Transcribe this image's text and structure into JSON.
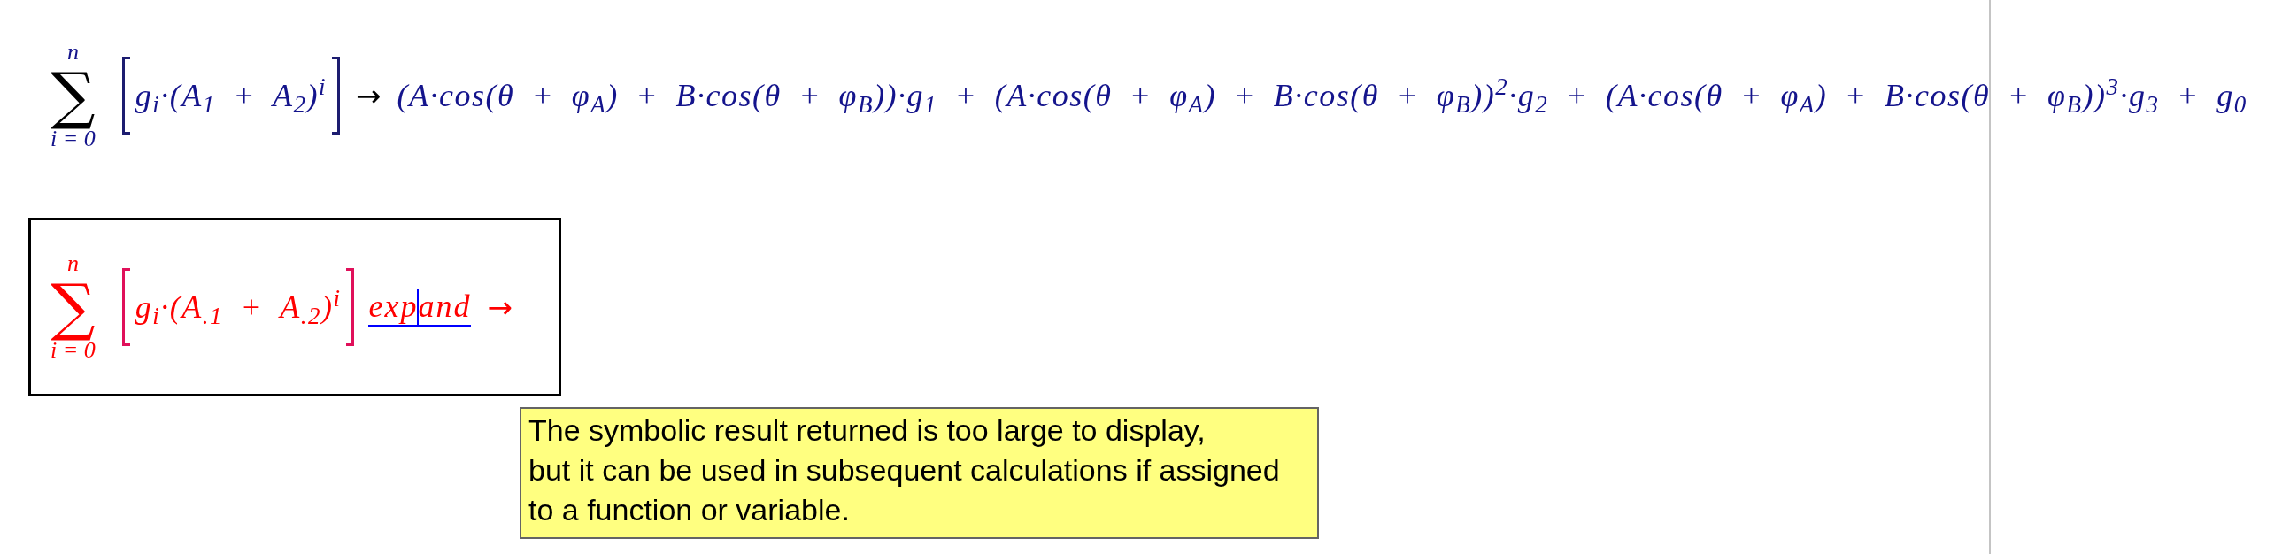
{
  "worksheet": {
    "regions": [
      {
        "selected": false,
        "error": false,
        "sum": {
          "symbol": "∑",
          "upper": "n",
          "lower": "i = 0"
        },
        "summand": "g$_{i}$·(A$_{1}$ + A$_{2}$)$^{i}$",
        "arrow": "→",
        "result": "(A·cos(θ + φ$_{A}$) + B·cos(θ + φ$_{B}$))·g$_{1}$ + (A·cos(θ + φ$_{A}$) + B·cos(θ + φ$_{B}$))$^{2}$·g$_{2}$ + (A·cos(θ + φ$_{A}$) + B·cos(θ + φ$_{B}$))$^{3}$·g$_{3}$ + g$_{0}$"
      },
      {
        "selected": true,
        "error": true,
        "sum": {
          "symbol": "∑",
          "upper": "n",
          "lower": "i = 0"
        },
        "summand": "g$_{i}$·(A$_{.1}$ + A$_{.2}$)$^{i}$",
        "keyword": {
          "text": "expand",
          "editing": true
        },
        "arrow": "→"
      }
    ]
  },
  "tooltip": {
    "text": "The symbolic result returned is too large to display,\nbut it can be used in subsequent calculations if assigned\nto a function or variable."
  }
}
